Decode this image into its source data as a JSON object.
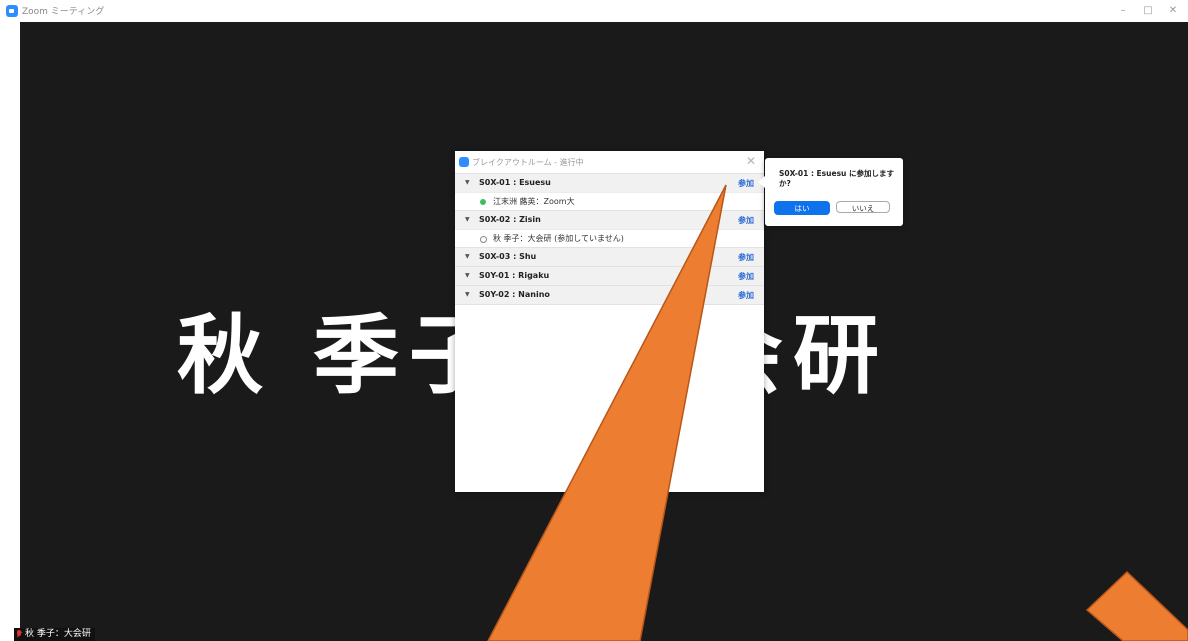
{
  "window": {
    "title": "Zoom ミーティング",
    "minimize": "–",
    "maximize": "□",
    "close": "✕"
  },
  "video": {
    "display_name": "秋 季子：大会研",
    "name_tag": "秋 季子：大会研"
  },
  "panel": {
    "title": "ブレイクアウトルーム - 進行中",
    "close": "✕",
    "join_label": "参加",
    "rooms": [
      {
        "name": "S0X-01 : Esuesu",
        "participants": [
          {
            "name": "江末洲 蕗英：Zoom大",
            "joined": true
          }
        ]
      },
      {
        "name": "S0X-02 : Zisin",
        "participants": [
          {
            "name": "秋 季子：大会研 (参加していません)",
            "joined": false
          }
        ]
      },
      {
        "name": "S0X-03 : Shu",
        "participants": []
      },
      {
        "name": "S0Y-01 : Rigaku",
        "participants": []
      },
      {
        "name": "S0Y-02 : Nanino",
        "participants": []
      }
    ]
  },
  "popover": {
    "message": "S0X-01 : Esuesu に参加しますか?",
    "yes": "はい",
    "no": "いいえ"
  },
  "colors": {
    "accent": "#0e72ed",
    "link": "#2d6bd4",
    "annotation": "#ed7d31",
    "video_bg": "#1a1a1a",
    "online": "#3ebd60"
  }
}
